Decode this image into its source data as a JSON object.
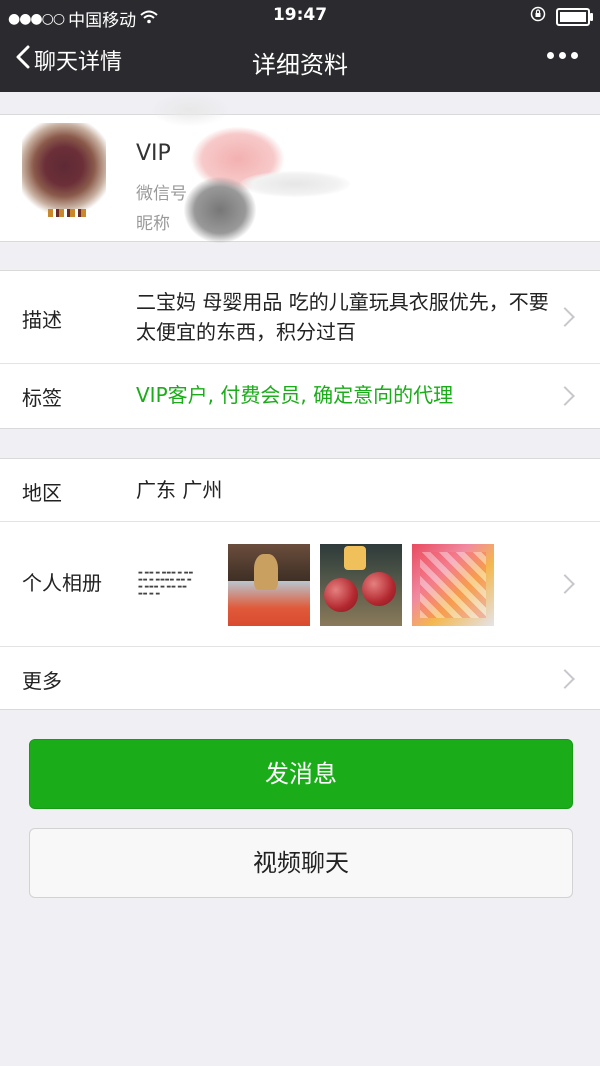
{
  "status_bar": {
    "carrier": "中国移动",
    "time": "19:47"
  },
  "nav": {
    "back_label": "聊天详情",
    "title": "详细资料"
  },
  "profile": {
    "name": "VIP",
    "wechat_id_label": "微信号",
    "nickname_label": "昵称"
  },
  "details": {
    "description_label": "描述",
    "description_value": "二宝妈 母婴用品 吃的儿童玩具衣服优先，不要太便宜的东西，积分过百",
    "tags_label": "标签",
    "tags_value": "VIP客户, 付费会员, 确定意向的代理"
  },
  "info": {
    "region_label": "地区",
    "region_value": "广东  广州",
    "album_label": "个人相册",
    "more_label": "更多"
  },
  "actions": {
    "send_message": "发消息",
    "video_chat": "视频聊天"
  },
  "colors": {
    "accent": "#1aad19",
    "nav_background": "#2b2b2f",
    "page_background": "#efeff4"
  }
}
